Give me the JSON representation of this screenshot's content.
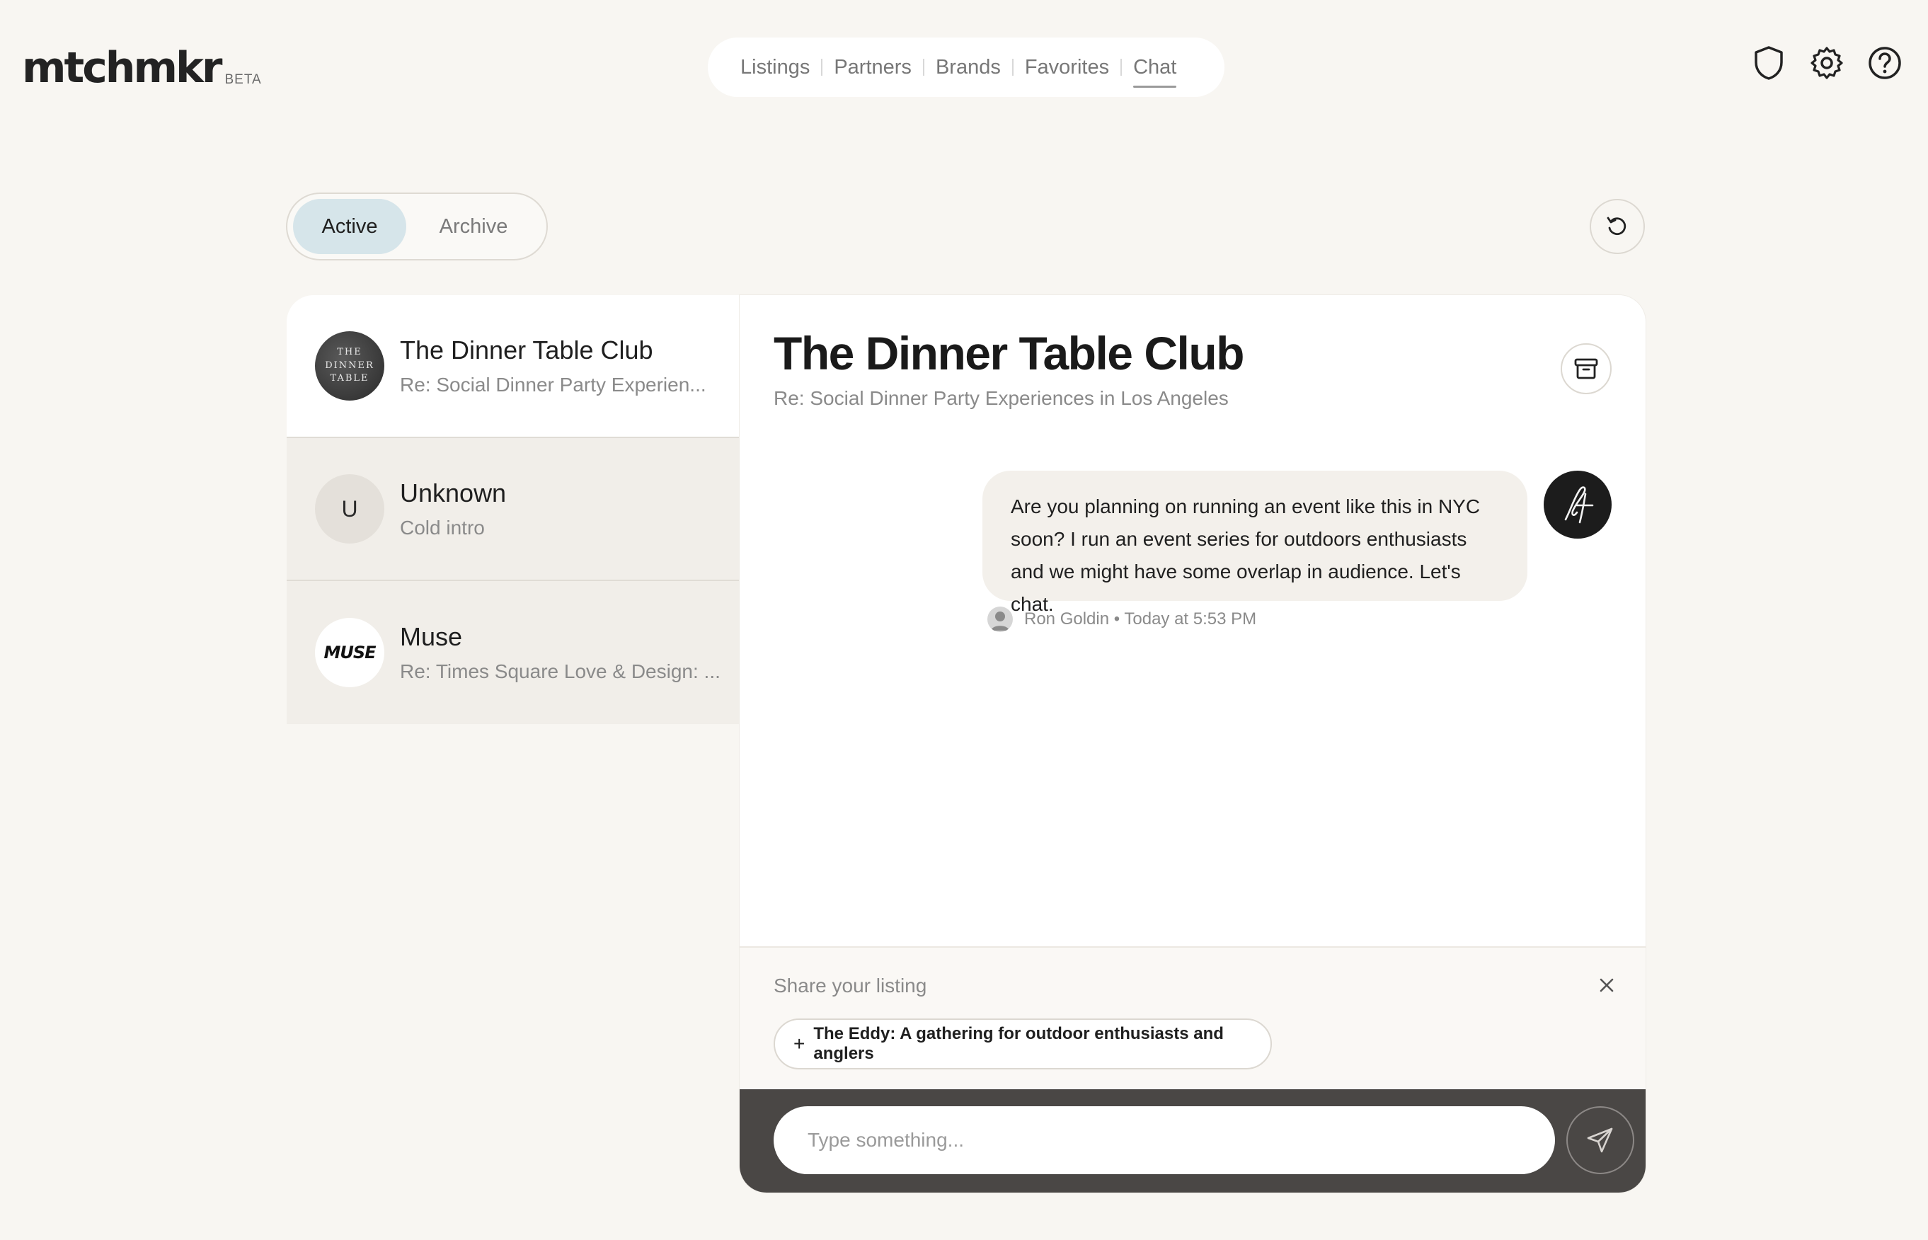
{
  "brand": {
    "name": "mtchmkr",
    "badge": "BETA"
  },
  "nav": {
    "items": [
      {
        "label": "Listings"
      },
      {
        "label": "Partners"
      },
      {
        "label": "Brands"
      },
      {
        "label": "Favorites"
      },
      {
        "label": "Chat",
        "active": true
      }
    ]
  },
  "header_icons": [
    "shield-icon",
    "gear-icon",
    "help-icon"
  ],
  "tabs": {
    "active": "Active",
    "archive": "Archive"
  },
  "conversations": [
    {
      "name": "The Dinner Table Club",
      "subtitle": "Re: Social Dinner Party Experien...",
      "avatar_text": "THE DINNER TABLE",
      "selected": true
    },
    {
      "name": "Unknown",
      "subtitle": "Cold intro",
      "avatar_text": "U"
    },
    {
      "name": "Muse",
      "subtitle": "Re: Times Square Love & Design: ...",
      "avatar_text": "MUSE"
    }
  ],
  "chat": {
    "title": "The Dinner Table Club",
    "subtitle": "Re: Social Dinner Party Experiences in Los Angeles",
    "message": {
      "text": "Are you planning on running an event like this in NYC soon? I run an event series for outdoors enthusiasts and we might have some overlap in audience. Let's chat.",
      "meta": "Ron Goldin • Today at 5:53 PM"
    }
  },
  "share": {
    "label": "Share your listing",
    "listing": "The Eddy: A gathering for outdoor enthusiasts and anglers"
  },
  "composer": {
    "placeholder": "Type something..."
  },
  "colors": {
    "background": "#f8f6f2",
    "active_tab": "#d6e5ea",
    "composer_bar": "#4a4745"
  }
}
